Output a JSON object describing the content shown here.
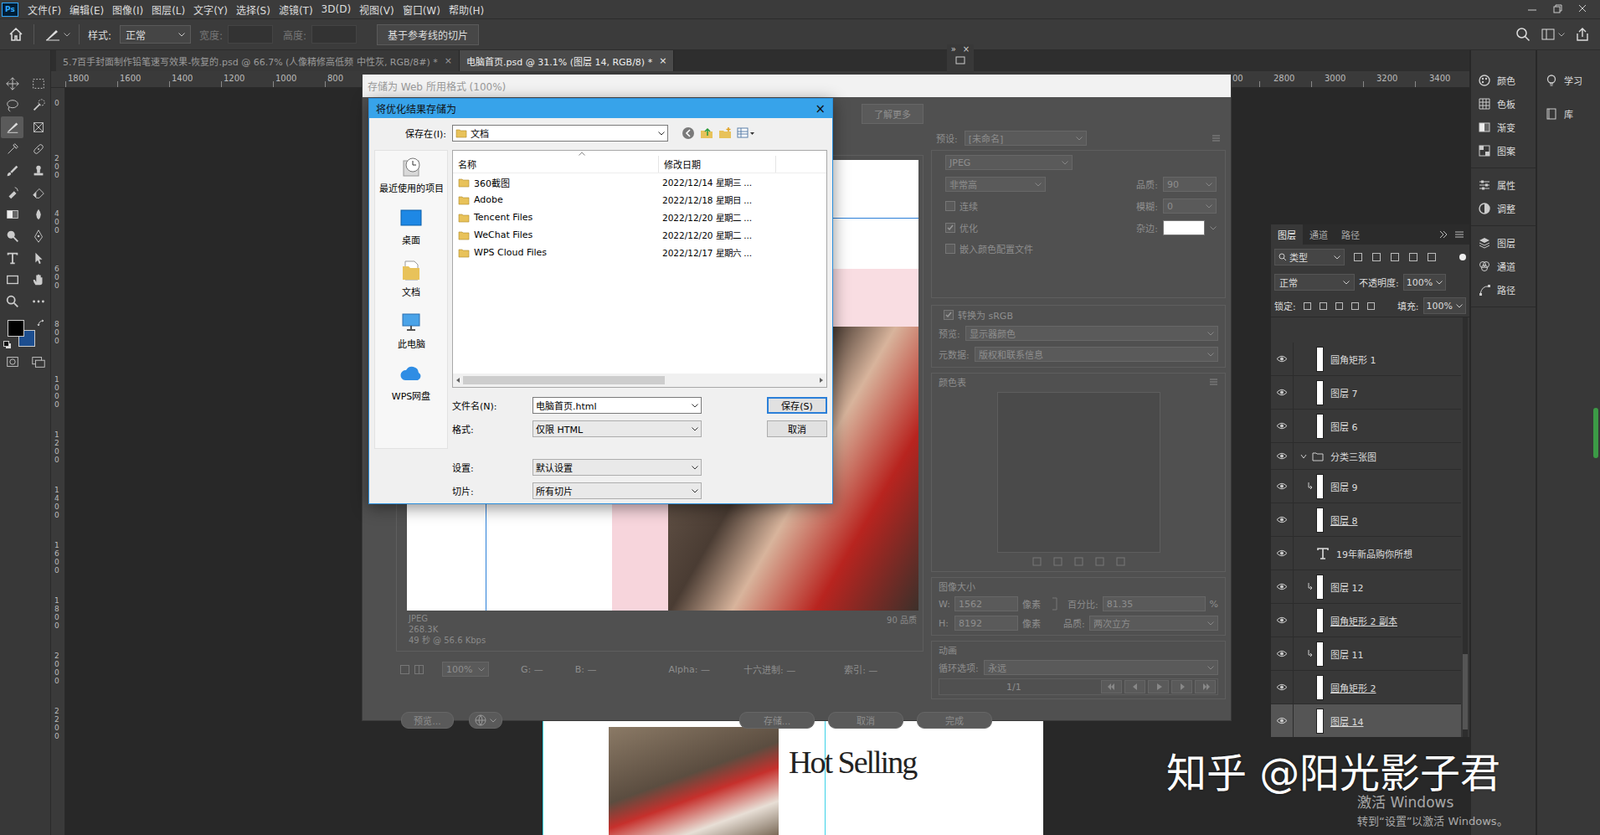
{
  "app": {
    "logo": "Ps",
    "menu": [
      "文件(F)",
      "编辑(E)",
      "图像(I)",
      "图层(L)",
      "文字(Y)",
      "选择(S)",
      "滤镜(T)",
      "3D(D)",
      "视图(V)",
      "窗口(W)",
      "帮助(H)"
    ]
  },
  "options_bar": {
    "style_label": "样式:",
    "style_value": "正常",
    "width_label": "宽度:",
    "height_label": "高度:",
    "slice_button": "基于参考线的切片"
  },
  "doc_tabs": [
    {
      "label": "5.7百手封面制作铅笔速写效果-恢复的.psd @ 66.7% (人像精修高低频 中性灰, RGB/8#) *",
      "close": "×",
      "selected": false
    },
    {
      "label": "电脑首页.psd @ 31.1% (图层 14, RGB/8) *",
      "close": "×",
      "selected": true
    }
  ],
  "panel_stub": {
    "expand": "»",
    "close": "×"
  },
  "rulers": {
    "top_left": [
      "1800",
      "1600",
      "1400",
      "1200",
      "1000",
      "800"
    ],
    "top_right": [
      "00",
      "2800",
      "3000",
      "3200",
      "3400"
    ],
    "left": [
      "0",
      "200",
      "400",
      "600",
      "800",
      "1000",
      "1200",
      "1400",
      "1600",
      "1800",
      "2000",
      "2200"
    ]
  },
  "tools": [
    {
      "kind": "move",
      "selected": false
    },
    {
      "kind": "marquee",
      "selected": false
    },
    {
      "kind": "lasso",
      "selected": false
    },
    {
      "kind": "quickselect",
      "selected": false
    },
    {
      "kind": "slice",
      "selected": true
    },
    {
      "kind": "frame",
      "selected": false
    },
    {
      "kind": "eyedropper",
      "selected": false
    },
    {
      "kind": "healing",
      "selected": false
    },
    {
      "kind": "brush",
      "selected": false
    },
    {
      "kind": "stamp",
      "selected": false
    },
    {
      "kind": "history",
      "selected": false
    },
    {
      "kind": "eraser",
      "selected": false
    },
    {
      "kind": "gradient",
      "selected": false
    },
    {
      "kind": "blur",
      "selected": false
    },
    {
      "kind": "dodge",
      "selected": false
    },
    {
      "kind": "pen",
      "selected": false
    },
    {
      "kind": "text",
      "selected": false
    },
    {
      "kind": "pathselect",
      "selected": false
    },
    {
      "kind": "rect",
      "selected": false
    },
    {
      "kind": "hand",
      "selected": false
    },
    {
      "kind": "zoom",
      "selected": false
    },
    {
      "kind": "more",
      "selected": false
    }
  ],
  "mode_tools": [
    {
      "kind": "quickmask",
      "selected": false
    },
    {
      "kind": "screenmode",
      "selected": false
    }
  ],
  "swatches": {
    "foreground": "#000000",
    "background": "#1d4e8f"
  },
  "web_dialog": {
    "title": "存储为 Web 所用格式 (100%)",
    "learn_more": "了解更多",
    "preview_info": {
      "format": "JPEG",
      "size": "268.3K",
      "time": "49 秒 @ 56.6 Kbps",
      "quality": "90 品质"
    },
    "status": {
      "zoom": "100%",
      "g": "G: —",
      "b": "B: —",
      "alpha": "Alpha: —",
      "hex": "十六进制: —",
      "index": "索引: —"
    },
    "buttons": {
      "preview": "预览...",
      "save": "存储...",
      "cancel": "取消",
      "done": "完成"
    },
    "settings": {
      "preset_label": "预设:",
      "preset_value": "[未命名]",
      "format": "JPEG",
      "quality_preset": "非常高",
      "quality_label": "品质:",
      "quality_value": "90",
      "blur_label": "模糊:",
      "blur_value": "0",
      "matte_label": "杂边:",
      "checks": [
        {
          "label": "连续",
          "checked": false
        },
        {
          "label": "优化",
          "checked": true
        },
        {
          "label": "嵌入颜色配置文件",
          "checked": false
        },
        {
          "label": "转换为 sRGB",
          "checked": true
        }
      ],
      "preview_label": "预览:",
      "preview_value": "显示器颜色",
      "metadata_label": "元数据:",
      "metadata_value": "版权和联系信息",
      "color_table": "颜色表",
      "image_size": "图像大小",
      "w_label": "W:",
      "w_value": "1562",
      "w_unit": "像素",
      "h_label": "H:",
      "h_value": "8192",
      "h_unit": "像素",
      "percent_label": "百分比:",
      "percent_value": "81.35",
      "percent_unit": "%",
      "resample_label": "品质:",
      "resample_value": "两次立方",
      "animation": "动画",
      "loop_label": "循环选项:",
      "loop_value": "永远",
      "frame": "1/1"
    }
  },
  "save_dialog": {
    "title": "将优化结果存储为",
    "close": "×",
    "location_label": "保存在(I):",
    "location_value": "文档",
    "places": [
      {
        "label": "最近使用的项目",
        "kind": "recent"
      },
      {
        "label": "桌面",
        "kind": "desktop"
      },
      {
        "label": "文档",
        "kind": "documents"
      },
      {
        "label": "此电脑",
        "kind": "computer"
      },
      {
        "label": "WPS网盘",
        "kind": "cloud"
      }
    ],
    "columns": [
      "名称",
      "修改日期"
    ],
    "rows": [
      {
        "name": "360截图",
        "date": "2022/12/14 星期三 ..."
      },
      {
        "name": "Adobe",
        "date": "2022/12/18 星期日 ..."
      },
      {
        "name": "Tencent Files",
        "date": "2022/12/20 星期二 ..."
      },
      {
        "name": "WeChat Files",
        "date": "2022/12/20 星期二 ..."
      },
      {
        "name": "WPS Cloud Files",
        "date": "2022/12/17 星期六 ..."
      }
    ],
    "fields": [
      {
        "label": "文件名(N):",
        "value": "电脑首页.html",
        "kind": "combo"
      },
      {
        "label": "格式:",
        "value": "仅限 HTML",
        "kind": "select"
      },
      {
        "label": "设置:",
        "value": "默认设置",
        "kind": "select"
      },
      {
        "label": "切片:",
        "value": "所有切片",
        "kind": "select"
      }
    ],
    "buttons": [
      {
        "label": "保存(S)",
        "default": true
      },
      {
        "label": "取消",
        "default": false
      }
    ]
  },
  "layers": {
    "tabs": [
      {
        "label": "图层",
        "selected": true
      },
      {
        "label": "通道",
        "selected": false
      },
      {
        "label": "路径",
        "selected": false
      }
    ],
    "filter": "类型",
    "blend": "正常",
    "opacity_label": "不透明度:",
    "opacity_value": "100%",
    "lock_label": "锁定:",
    "fill_label": "填充:",
    "fill_value": "100%",
    "items": [
      {
        "name": "圆角矩形 1",
        "kind": "layer",
        "visible": true,
        "clipped": false,
        "base": false,
        "selected": false
      },
      {
        "name": "图层 7",
        "kind": "layer",
        "visible": true,
        "clipped": false,
        "base": false,
        "selected": false
      },
      {
        "name": "图层 6",
        "kind": "layer",
        "visible": true,
        "clipped": false,
        "base": false,
        "selected": false
      },
      {
        "name": "分类三张图",
        "kind": "group",
        "visible": true,
        "expanded": true,
        "clipped": false,
        "base": false,
        "selected": false
      },
      {
        "name": "图层 9",
        "kind": "layer",
        "visible": true,
        "clipped": true,
        "base": false,
        "selected": false
      },
      {
        "name": "图层 8",
        "kind": "layer",
        "visible": true,
        "clipped": false,
        "base": true,
        "selected": false
      },
      {
        "name": "19年新品购你所想",
        "kind": "text",
        "visible": true,
        "clipped": false,
        "base": false,
        "selected": false
      },
      {
        "name": "图层 12",
        "kind": "layer",
        "visible": true,
        "clipped": true,
        "base": false,
        "selected": false
      },
      {
        "name": "圆角矩形 2 副本",
        "kind": "layer",
        "visible": true,
        "clipped": false,
        "base": true,
        "selected": false
      },
      {
        "name": "图层 11",
        "kind": "layer",
        "visible": true,
        "clipped": true,
        "base": false,
        "selected": false
      },
      {
        "name": "圆角矩形 2",
        "kind": "layer",
        "visible": true,
        "clipped": false,
        "base": true,
        "selected": false
      },
      {
        "name": "图层 14",
        "kind": "layer",
        "visible": true,
        "clipped": false,
        "base": true,
        "selected": true
      }
    ]
  },
  "dock": {
    "groups": [
      [
        {
          "label": "颜色",
          "kind": "color"
        },
        {
          "label": "色板",
          "kind": "swatches"
        },
        {
          "label": "渐变",
          "kind": "gradient"
        },
        {
          "label": "图案",
          "kind": "pattern"
        }
      ],
      [
        {
          "label": "属性",
          "kind": "properties"
        },
        {
          "label": "调整",
          "kind": "adjustments"
        }
      ],
      [
        {
          "label": "图层",
          "kind": "layers"
        },
        {
          "label": "通道",
          "kind": "channels"
        },
        {
          "label": "路径",
          "kind": "paths"
        }
      ]
    ],
    "extra": [
      {
        "label": "学习",
        "kind": "learn"
      },
      {
        "label": "库",
        "kind": "library"
      }
    ]
  },
  "canvas": {
    "headline": "Hot Selling"
  },
  "watermark": {
    "brand": "知乎 @阳光影子君",
    "activate_title": "激活 Windows",
    "activate_hint": "转到“设置”以激活 Windows。"
  }
}
